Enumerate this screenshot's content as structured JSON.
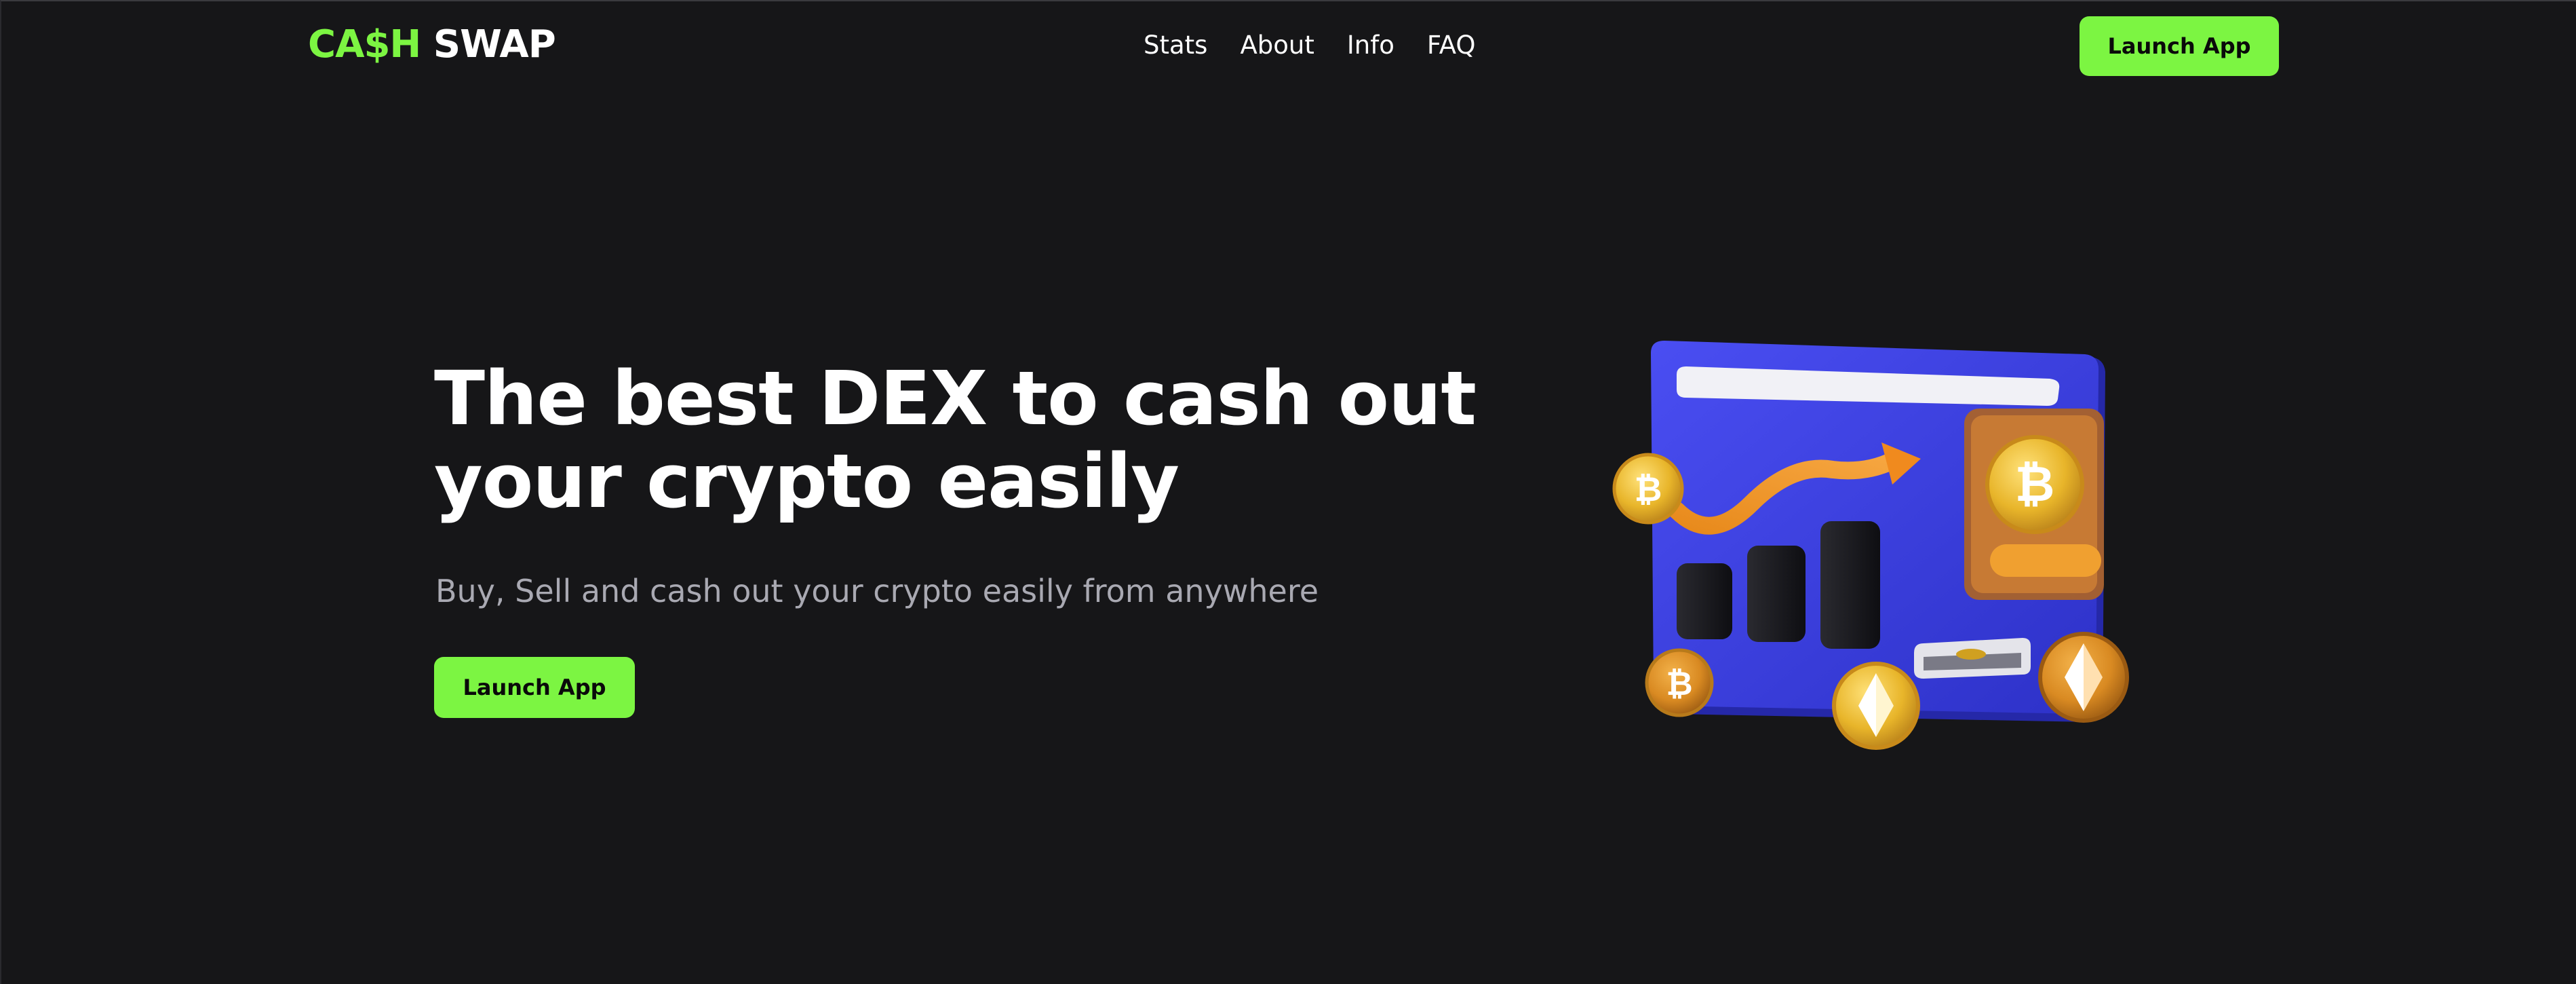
{
  "header": {
    "logo": {
      "accent": "CA$H",
      "main": " SWAP"
    },
    "nav": [
      {
        "label": "Stats"
      },
      {
        "label": "About"
      },
      {
        "label": "Info"
      },
      {
        "label": "FAQ"
      }
    ],
    "cta_label": "Launch App"
  },
  "hero": {
    "title_line1": "The best DEX to cash out",
    "title_line2": "your crypto easily",
    "subtitle": "Buy, Sell and cash out your crypto easily from anywhere",
    "cta_label": "Launch App"
  },
  "illustration": {
    "icons": [
      "wallet-card-icon",
      "trend-arrow-icon",
      "bitcoin-coin-icon",
      "ethereum-coin-icon",
      "card-slot-icon"
    ]
  },
  "colors": {
    "background": "#161618",
    "accent": "#7cf542",
    "text": "#ffffff",
    "muted_text": "#a9a9b2",
    "card_blue": "#3b3fe0",
    "coin_gold": "#e8b52a",
    "trend_orange": "#f0902a"
  }
}
